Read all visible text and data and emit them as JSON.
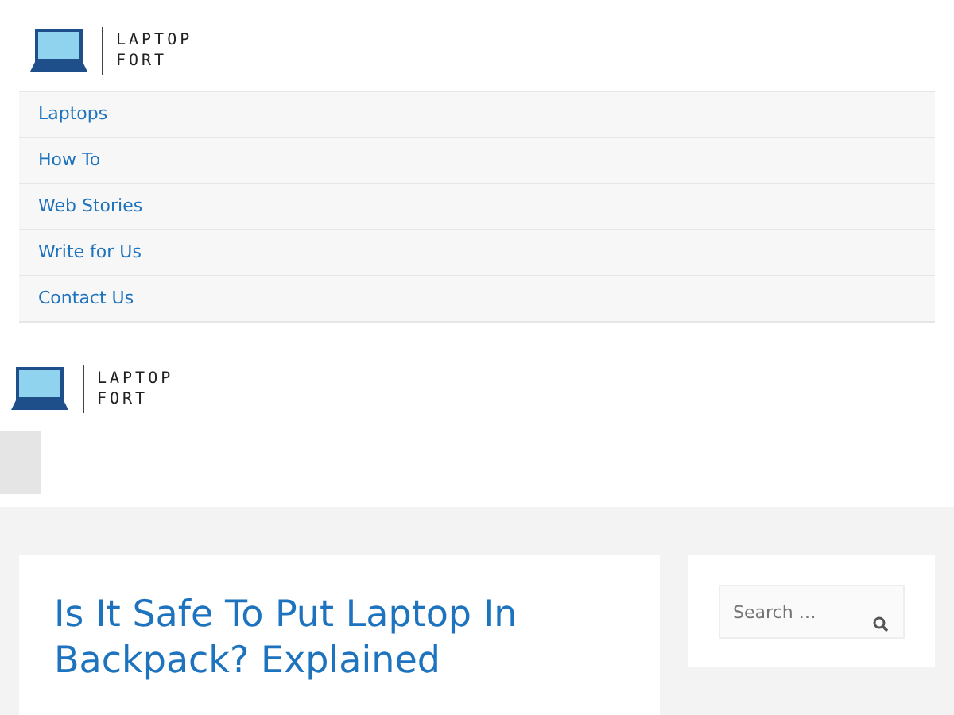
{
  "header": {
    "logo": [
      "LAPTOP",
      "FORT"
    ]
  },
  "nav": {
    "items": [
      {
        "label": "Laptops"
      },
      {
        "label": "How To"
      },
      {
        "label": "Web Stories"
      },
      {
        "label": "Write for Us"
      },
      {
        "label": "Contact Us"
      }
    ]
  },
  "mobile_header": {
    "logo": [
      "LAPTOP",
      "FORT"
    ]
  },
  "article": {
    "title": "Is It Safe To Put Laptop In Backpack? Explained"
  },
  "sidebar": {
    "search": {
      "placeholder": "Search …"
    }
  }
}
